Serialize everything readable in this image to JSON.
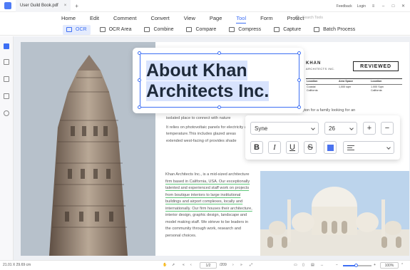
{
  "titlebar": {
    "doc_tab": "User Guild Book.pdf",
    "close_glyph": "×",
    "new_tab_glyph": "+",
    "feedback": "Feedback",
    "login": "Login"
  },
  "menu": {
    "items": [
      "Home",
      "Edit",
      "Comment",
      "Convert",
      "View",
      "Page",
      "Tool",
      "Form",
      "Protect"
    ],
    "active": "Tool",
    "search_placeholder": "Search Tools"
  },
  "toolbar": {
    "items": [
      "OCR",
      "OCR Area",
      "Combine",
      "Compare",
      "Compress",
      "Capture",
      "Batch Process"
    ],
    "active": "OCR"
  },
  "document": {
    "title_line1": "About Khan",
    "title_line2": "Architects Inc.",
    "brand_name": "KHAN",
    "brand_sub": "ARCHITECTS INC.",
    "stamp": "REVIEWED",
    "table_headers": [
      "Location",
      "Area Space",
      "Location"
    ],
    "table_values": [
      "Coastal\nCalifornia",
      "1,000 sqm",
      "1.000 Sqm\nCalifornia"
    ],
    "left_para_top": [
      "isolated place to connect with nature",
      "It relies on photovoltaic panels for electricity and pa",
      "temperature.This includes glazed areas",
      "extended west-facing of provides shade"
    ],
    "right_para_top": "ington for a family looking for an",
    "left_para_main": [
      "Khan Architects Inc., is a mid-sized architecture",
      "firm based in California, USA. Our exceptionally",
      "talented and experienced staff work on projects",
      "from boutique interiors to large institutional",
      "buildings and airport complexes, locally and",
      "internationally. Our firm houses their architecture,",
      "interior design, graphic design, landscape and",
      "model making staff. We strieve to be leaders in",
      "the community through work, research and",
      "personal choices."
    ]
  },
  "format_panel": {
    "font": "Syne",
    "size": "26",
    "plus": "+",
    "minus": "−",
    "bold": "B",
    "italic": "I",
    "underline": "U",
    "strike": "S",
    "text_color": "#4b73ef"
  },
  "statusbar": {
    "dimensions": "21.01 X 29.69 cm",
    "page_current": "1/2",
    "page_total": "/209",
    "zoom_percent": 0.45,
    "zoom_label": "100%"
  },
  "colors": {
    "accent": "#3d6ff4",
    "highlight": "#d8e3fd",
    "underline": "#5ec67a"
  }
}
